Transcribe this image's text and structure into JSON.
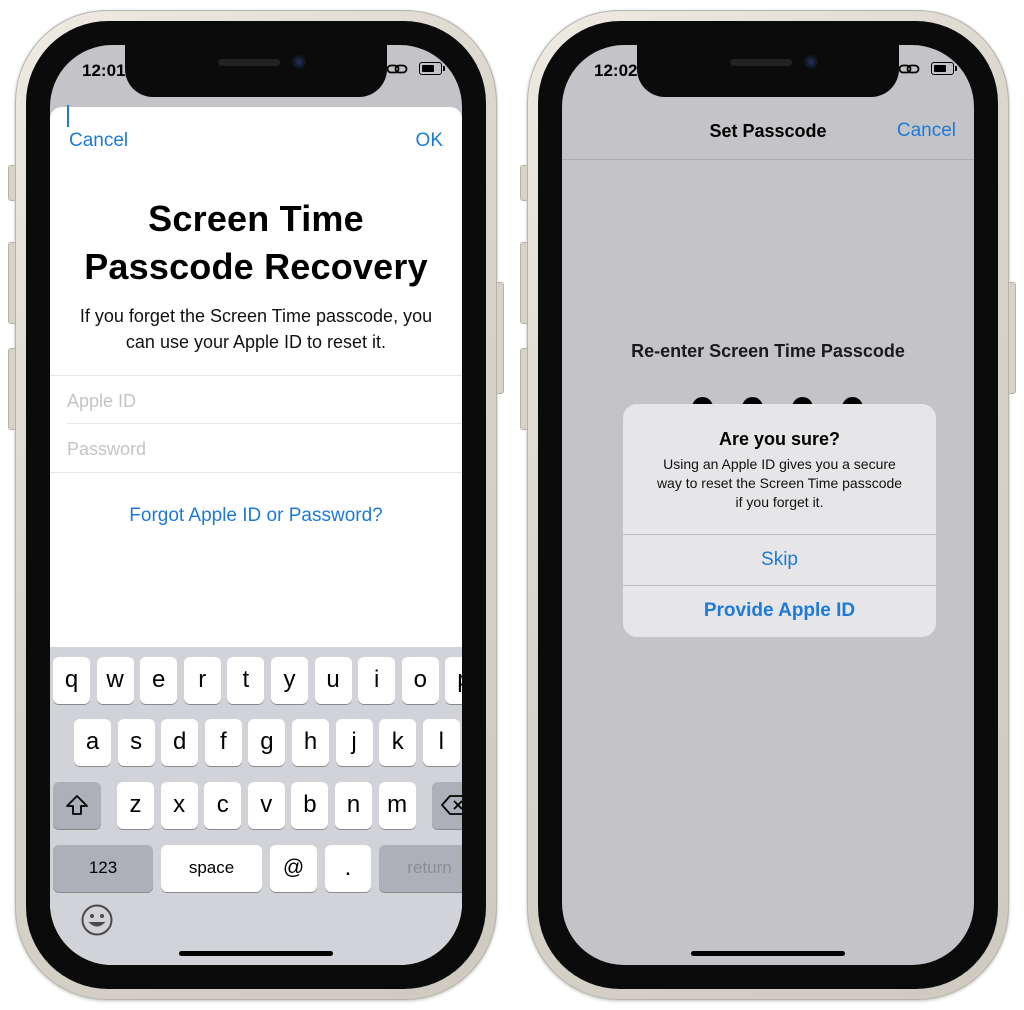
{
  "left_phone": {
    "status": {
      "time": "12:01"
    },
    "sheet": {
      "cancel_label": "Cancel",
      "ok_label": "OK",
      "title_line1": "Screen Time",
      "title_line2": "Passcode Recovery",
      "subtitle_line1": "If you forget the Screen Time passcode, you",
      "subtitle_line2": "can use your Apple ID to reset it.",
      "apple_id_placeholder": "Apple ID",
      "password_placeholder": "Password",
      "forgot_link": "Forgot Apple ID or Password?"
    },
    "keyboard": {
      "row1": [
        "q",
        "w",
        "e",
        "r",
        "t",
        "y",
        "u",
        "i",
        "o",
        "p"
      ],
      "row2": [
        "a",
        "s",
        "d",
        "f",
        "g",
        "h",
        "j",
        "k",
        "l"
      ],
      "row3": [
        "z",
        "x",
        "c",
        "v",
        "b",
        "n",
        "m"
      ],
      "numbers_label": "123",
      "space_label": "space",
      "at_label": "@",
      "period_label": ".",
      "return_label": "return",
      "shift_icon": "shift-icon",
      "delete_icon": "delete-icon",
      "emoji_icon": "emoji-icon"
    }
  },
  "right_phone": {
    "status": {
      "time": "12:02"
    },
    "nav": {
      "title": "Set Passcode",
      "cancel_label": "Cancel"
    },
    "prompt": "Re-enter Screen Time Passcode",
    "passcode_dots": 4,
    "alert": {
      "title": "Are you sure?",
      "message_line1": "Using an Apple ID gives you a secure",
      "message_line2": "way to reset the Screen Time passcode",
      "message_line3": "if you forget it.",
      "skip_label": "Skip",
      "provide_label": "Provide Apple ID"
    }
  },
  "colors": {
    "accent": "#1e7ad8",
    "frame": "#e2ded6",
    "keyboard_bg": "#d1d3d9",
    "dimmed_bg": "#c4c4c8"
  }
}
